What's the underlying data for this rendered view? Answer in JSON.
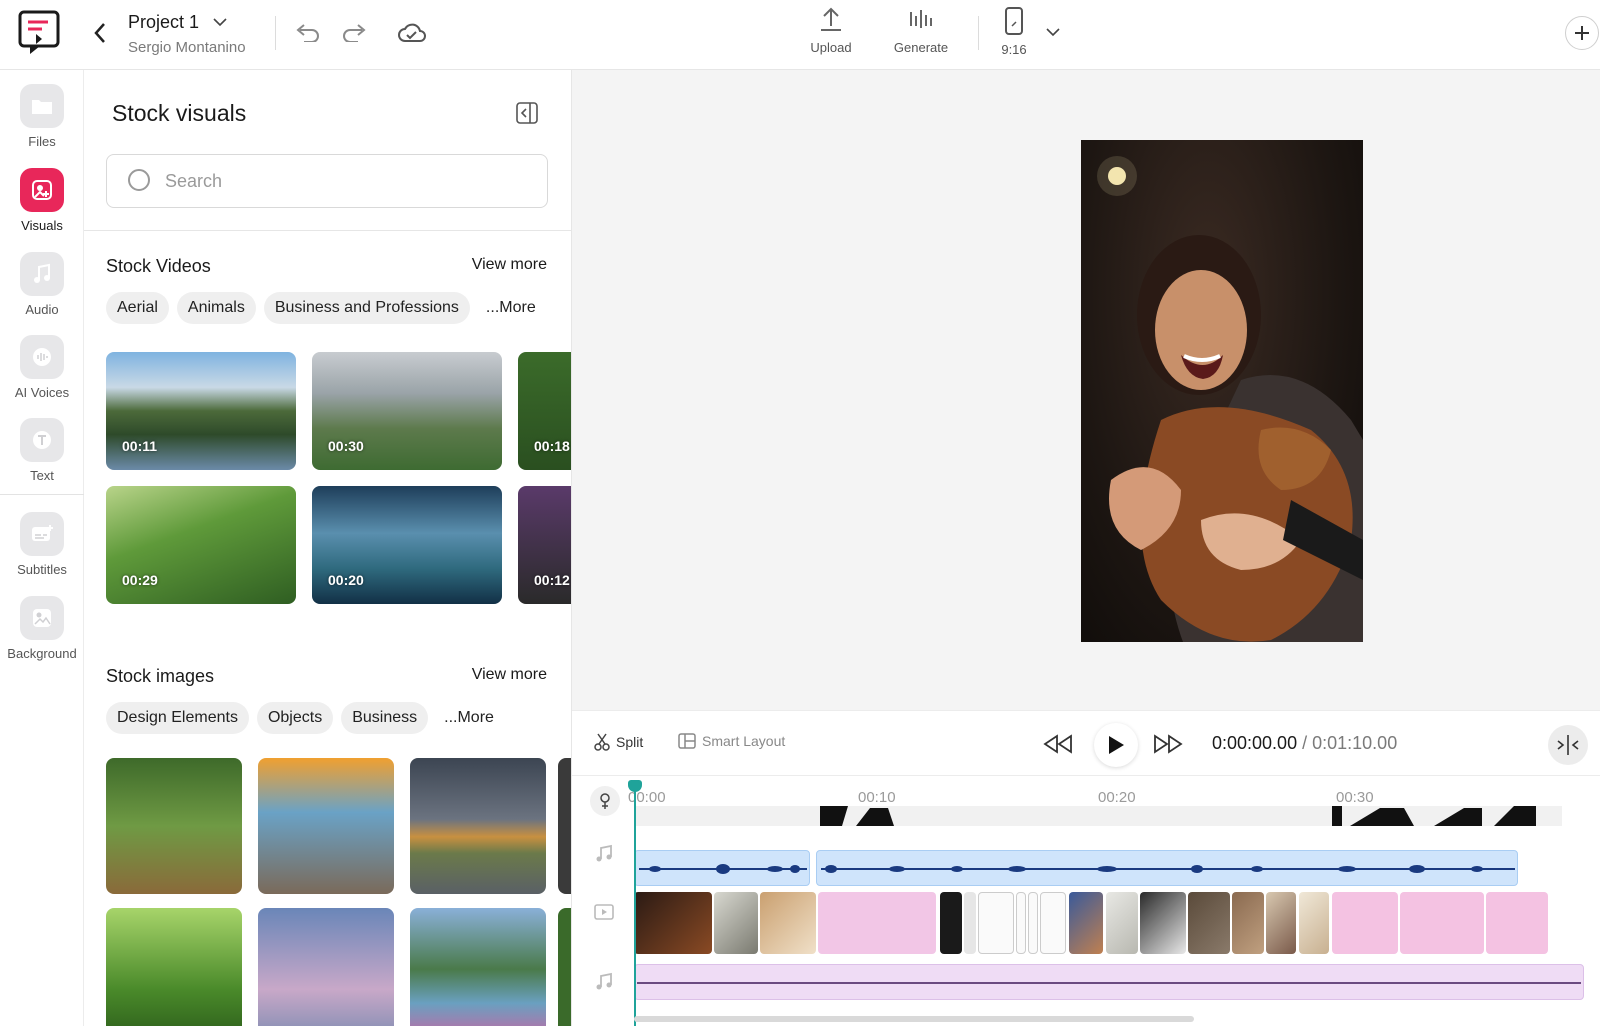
{
  "header": {
    "project_name": "Project 1",
    "owner": "Sergio Montanino",
    "tools": {
      "upload": "Upload",
      "generate": "Generate",
      "aspect": "9:16"
    }
  },
  "rail": {
    "files": "Files",
    "visuals": "Visuals",
    "audio": "Audio",
    "ai_voices": "AI Voices",
    "text": "Text",
    "subtitles": "Subtitles",
    "background": "Background"
  },
  "panel": {
    "title": "Stock visuals",
    "search_placeholder": "Search",
    "stock_videos": {
      "title": "Stock Videos",
      "view_more": "View more",
      "chips": [
        "Aerial",
        "Animals",
        "Business and Professions"
      ],
      "more": "...More",
      "items": [
        {
          "duration": "00:11"
        },
        {
          "duration": "00:30"
        },
        {
          "duration": "00:18"
        },
        {
          "duration": "00:29"
        },
        {
          "duration": "00:20"
        },
        {
          "duration": "00:12"
        }
      ]
    },
    "stock_images": {
      "title": "Stock images",
      "view_more": "View more",
      "chips": [
        "Design Elements",
        "Objects",
        "Business"
      ],
      "more": "...More"
    }
  },
  "controls": {
    "split": "Split",
    "smart_layout": "Smart Layout",
    "current_time": "0:00:00.00",
    "separator": "/",
    "total_time": "0:01:10.00"
  },
  "timeline": {
    "ticks": [
      "00:00",
      "00:10",
      "00:20",
      "00:30"
    ]
  },
  "colors": {
    "accent": "#e8275a",
    "playhead": "#1fa39a",
    "audio_clip": "#cfe4fb",
    "music_track": "#efdcf5"
  }
}
